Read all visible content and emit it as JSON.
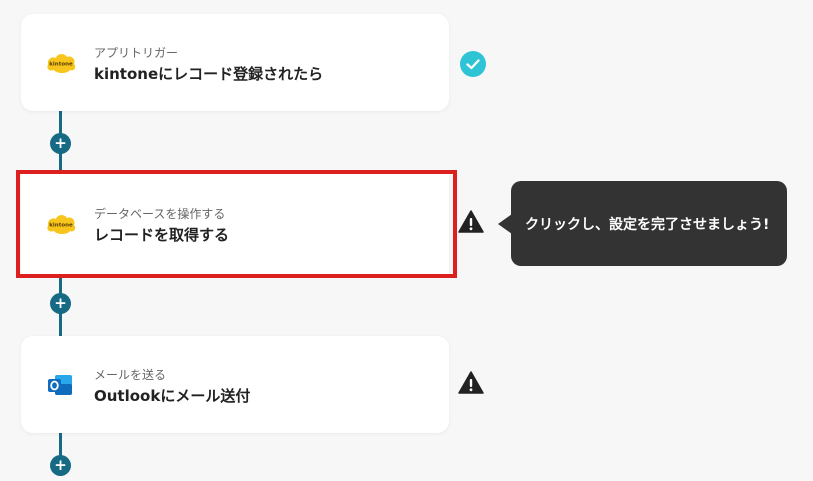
{
  "flow": {
    "steps": [
      {
        "subtitle": "アプリトリガー",
        "title": "kintoneにレコード登録されたら",
        "icon": "kintone-logo-icon",
        "status": "complete"
      },
      {
        "subtitle": "データベースを操作する",
        "title": "レコードを取得する",
        "icon": "kintone-logo-icon",
        "status": "warning"
      },
      {
        "subtitle": "メールを送る",
        "title": "Outlookにメール送付",
        "icon": "outlook-logo-icon",
        "status": "warning"
      }
    ],
    "add_step_symbol": "+"
  },
  "tooltip": {
    "text": "クリックし、設定を完了させましょう!"
  },
  "colors": {
    "background": "#f7f7f7",
    "connector": "#176a84",
    "highlight": "#dc2020",
    "complete": "#2ec4d6",
    "warning": "#222222",
    "tooltip_bg": "#333333",
    "kintone_yellow": "#f7c51c",
    "outlook_blue": "#0f6cbd"
  }
}
